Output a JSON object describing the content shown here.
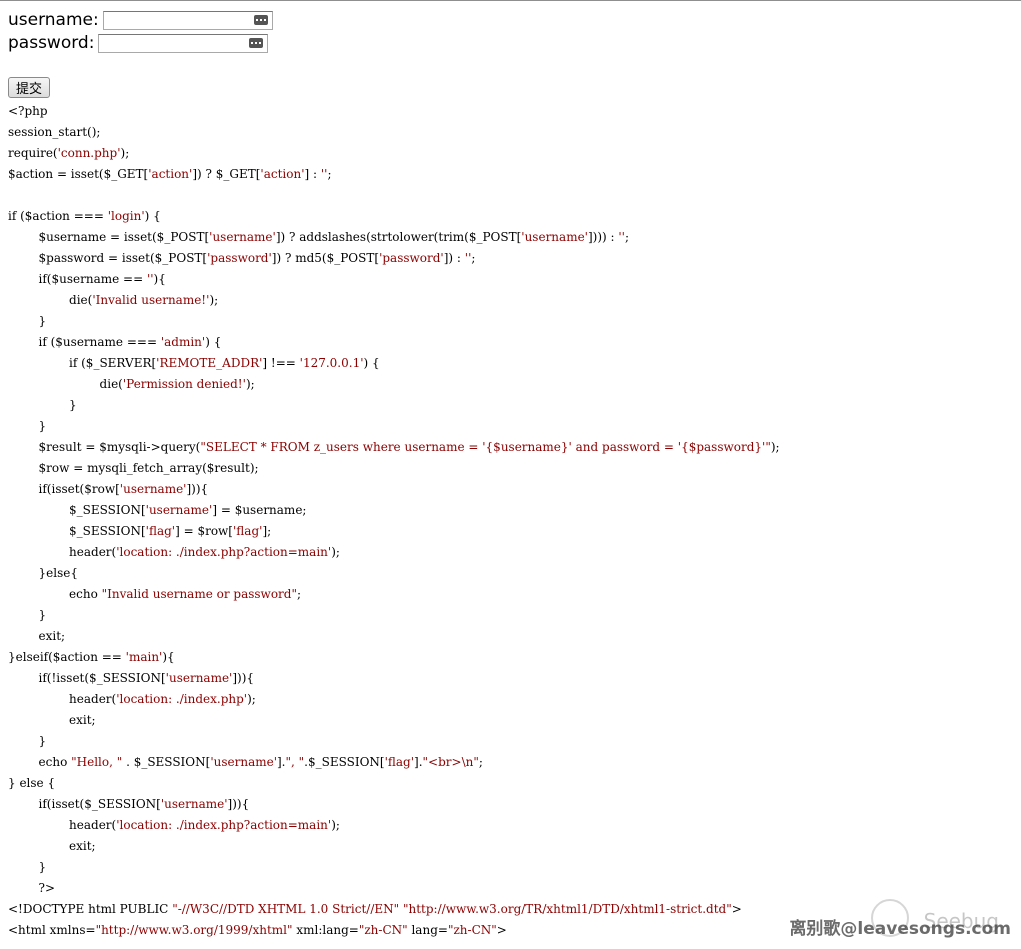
{
  "form": {
    "username_label": "username:",
    "password_label": "password:",
    "username_value": "",
    "password_value": "",
    "submit_label": "提交"
  },
  "code_lines": [
    "<?php",
    "session_start();",
    "require('conn.php');",
    "$action = isset($_GET['action']) ? $_GET['action'] : '';",
    "",
    "if ($action === 'login') {",
    "        $username = isset($_POST['username']) ? addslashes(strtolower(trim($_POST['username']))) : '';",
    "        $password = isset($_POST['password']) ? md5($_POST['password']) : '';",
    "        if($username == ''){",
    "                die('Invalid username!');",
    "        }",
    "        if ($username === 'admin') {",
    "                if ($_SERVER['REMOTE_ADDR'] !== '127.0.0.1') {",
    "                        die('Permission denied!');",
    "                }",
    "        }",
    "        $result = $mysqli->query(\"SELECT * FROM z_users where username = '{$username}' and password = '{$password}'\");",
    "        $row = mysqli_fetch_array($result);",
    "        if(isset($row['username'])){",
    "                $_SESSION['username'] = $username;",
    "                $_SESSION['flag'] = $row['flag'];",
    "                header('location: ./index.php?action=main');",
    "        }else{",
    "                echo \"Invalid username or password\";",
    "        }",
    "        exit;",
    "}elseif($action == 'main'){",
    "        if(!isset($_SESSION['username'])){",
    "                header('location: ./index.php');",
    "                exit;",
    "        }",
    "        echo \"Hello, \" . $_SESSION['username'].\", \".$_SESSION['flag'].\"<br>\\n\";",
    "} else {",
    "        if(isset($_SESSION['username'])){",
    "                header('location: ./index.php?action=main');",
    "                exit;",
    "        }",
    "        ?>",
    "<!DOCTYPE html PUBLIC \"-//W3C//DTD XHTML 1.0 Strict//EN\" \"http://www.w3.org/TR/xhtml1/DTD/xhtml1-strict.dtd\">",
    "<html xmlns=\"http://www.w3.org/1999/xhtml\" xml:lang=\"zh-CN\" lang=\"zh-CN\">"
  ],
  "watermark": {
    "text": "离别歌@leavesongs.com",
    "logo_text": "Seebug"
  },
  "icons": {
    "username_field_icon": "password-manager-key-icon",
    "password_field_icon": "password-manager-key-icon"
  }
}
